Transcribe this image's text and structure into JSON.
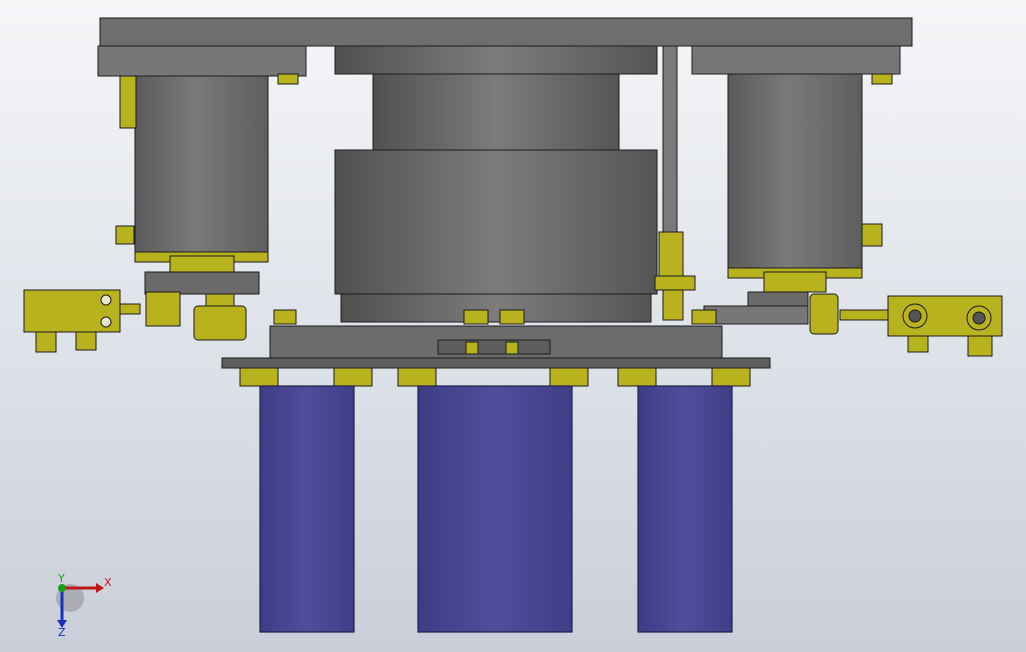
{
  "viewport": {
    "background_top": "#f5f6f8",
    "background_bottom": "#c9ced8"
  },
  "model": {
    "colors": {
      "steel": "#6f6f6f",
      "steel_dark": "#555555",
      "steel_light": "#8a8a8a",
      "brass": "#b7b21e",
      "brass_dark": "#7d7a10",
      "cylinder": "#4b4a96",
      "cylinder_edge": "#1f1f4a",
      "edge": "#1c1c1c"
    }
  },
  "triad": {
    "x_label": "X",
    "y_label": "Y",
    "z_label": "Z",
    "x_color": "#c01818",
    "y_color": "#18a018",
    "z_color": "#1830c0"
  }
}
